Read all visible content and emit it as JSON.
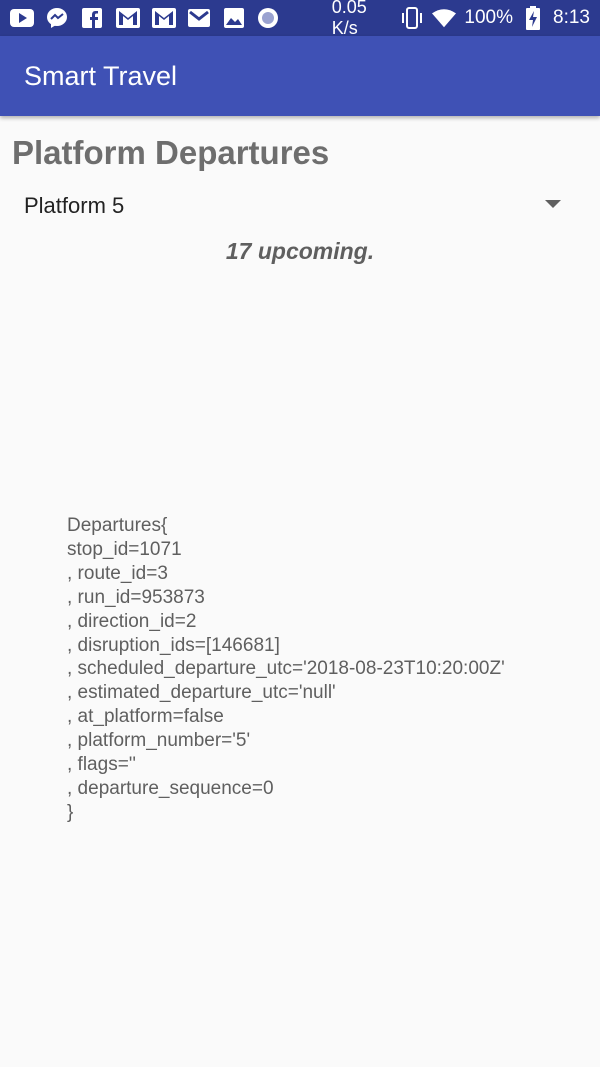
{
  "status_bar": {
    "icons_left": [
      "youtube-icon",
      "messenger-icon",
      "facebook-icon",
      "gmail-icon",
      "gmail-icon",
      "gmail-icon",
      "image-icon",
      "record-icon"
    ],
    "network_speed": "0.05 K/s",
    "battery": "100%",
    "time": "8:13"
  },
  "app_bar": {
    "title": "Smart Travel",
    "color": "#3f51b5"
  },
  "page": {
    "title": "Platform Departures"
  },
  "platform_spinner": {
    "selected": "Platform 5"
  },
  "upcoming_text": "17 upcoming.",
  "departure": {
    "lines": [
      "Departures{",
      "stop_id=1071",
      ", route_id=3",
      ", run_id=953873",
      ", direction_id=2",
      ", disruption_ids=[146681]",
      ", scheduled_departure_utc='2018-08-23T10:20:00Z'",
      ", estimated_departure_utc='null'",
      ", at_platform=false",
      ", platform_number='5'",
      ", flags=''",
      ", departure_sequence=0",
      "}"
    ]
  }
}
